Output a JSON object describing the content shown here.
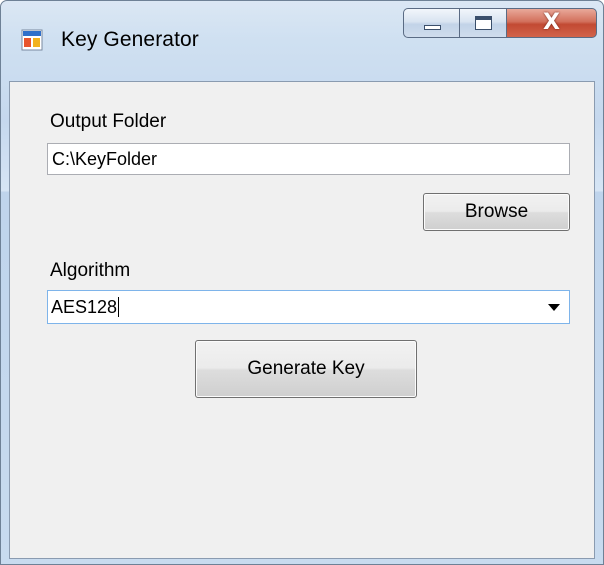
{
  "window": {
    "title": "Key Generator",
    "close_glyph": "X"
  },
  "form": {
    "output_folder_label": "Output Folder",
    "output_folder_value": "C:\\KeyFolder",
    "browse_label": "Browse",
    "algorithm_label": "Algorithm",
    "algorithm_value": "AES128",
    "generate_label": "Generate Key"
  },
  "icons": {
    "app": "app-window-icon",
    "minimize": "minimize-icon",
    "maximize": "maximize-icon",
    "close": "close-icon",
    "dropdown": "chevron-down-icon"
  },
  "colors": {
    "client_background": "#f0f0f0",
    "close_button": "#c24a33",
    "focus_border": "#7eb4ea"
  }
}
